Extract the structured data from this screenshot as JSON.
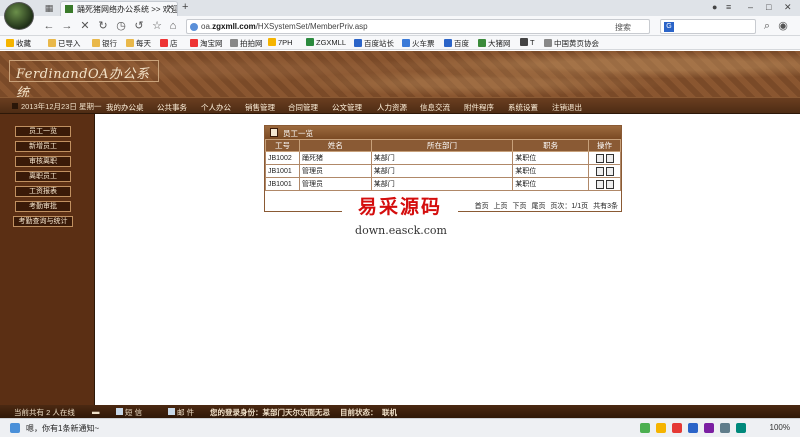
{
  "browser": {
    "tab_title": "踊死猪网络办公系统 >> 欢迎",
    "url_prefix": "oa.",
    "url_host": "zgxmll.com",
    "url_path": "/HXSystemSet/MemberPriv.asp",
    "search_engine": "搜索",
    "bookmarks": [
      "收藏",
      "已导入",
      "银行",
      "每天",
      "店",
      "淘宝网",
      "拍拍网",
      "7PH",
      "ZGXMLL",
      "百度站长",
      "火车票",
      "百度",
      "大猪网",
      "T",
      "中国黄页协会"
    ],
    "notice": "嗯，你有1条新通知~",
    "zoom": "100%"
  },
  "app": {
    "logo_title": "FerdinandOA办公系统",
    "date_text": "2013年12月23日 星期一",
    "menu": [
      "我的办公桌",
      "公共事务",
      "个人办公",
      "销售管理",
      "合同管理",
      "公文管理",
      "人力资源",
      "信息交流",
      "附件程序",
      "系统设置",
      "注销退出"
    ],
    "sidebar": [
      "员工一览",
      "新增员工",
      "审核离职",
      "离职员工",
      "工资报表",
      "考勤审批",
      "考勤查询与统计"
    ]
  },
  "panel": {
    "title": "员工一览",
    "columns": [
      "工号",
      "姓名",
      "所在部门",
      "职务",
      "操作"
    ],
    "rows": [
      {
        "id": "JB1002",
        "name": "踊死猪",
        "dept": "某部门",
        "title": "某职位"
      },
      {
        "id": "JB1001",
        "name": "管理员",
        "dept": "某部门",
        "title": "某职位"
      },
      {
        "id": "JB1001",
        "name": "管理员",
        "dept": "某部门",
        "title": "某职位"
      }
    ],
    "pager": {
      "first": "首页",
      "prev": "上页",
      "next": "下页",
      "last": "尾页",
      "info": "页次：1/1页",
      "total": "共有3条"
    }
  },
  "watermark": {
    "cn": "易采源码",
    "en": "down.easck.com"
  },
  "status": {
    "online": "当前共有 2 人在线",
    "sms": "短 信",
    "mail": "邮 件",
    "login": "您的登录身份：某部门天尔沃面无忌",
    "state": "目前状态：",
    "state_value": "联机"
  }
}
